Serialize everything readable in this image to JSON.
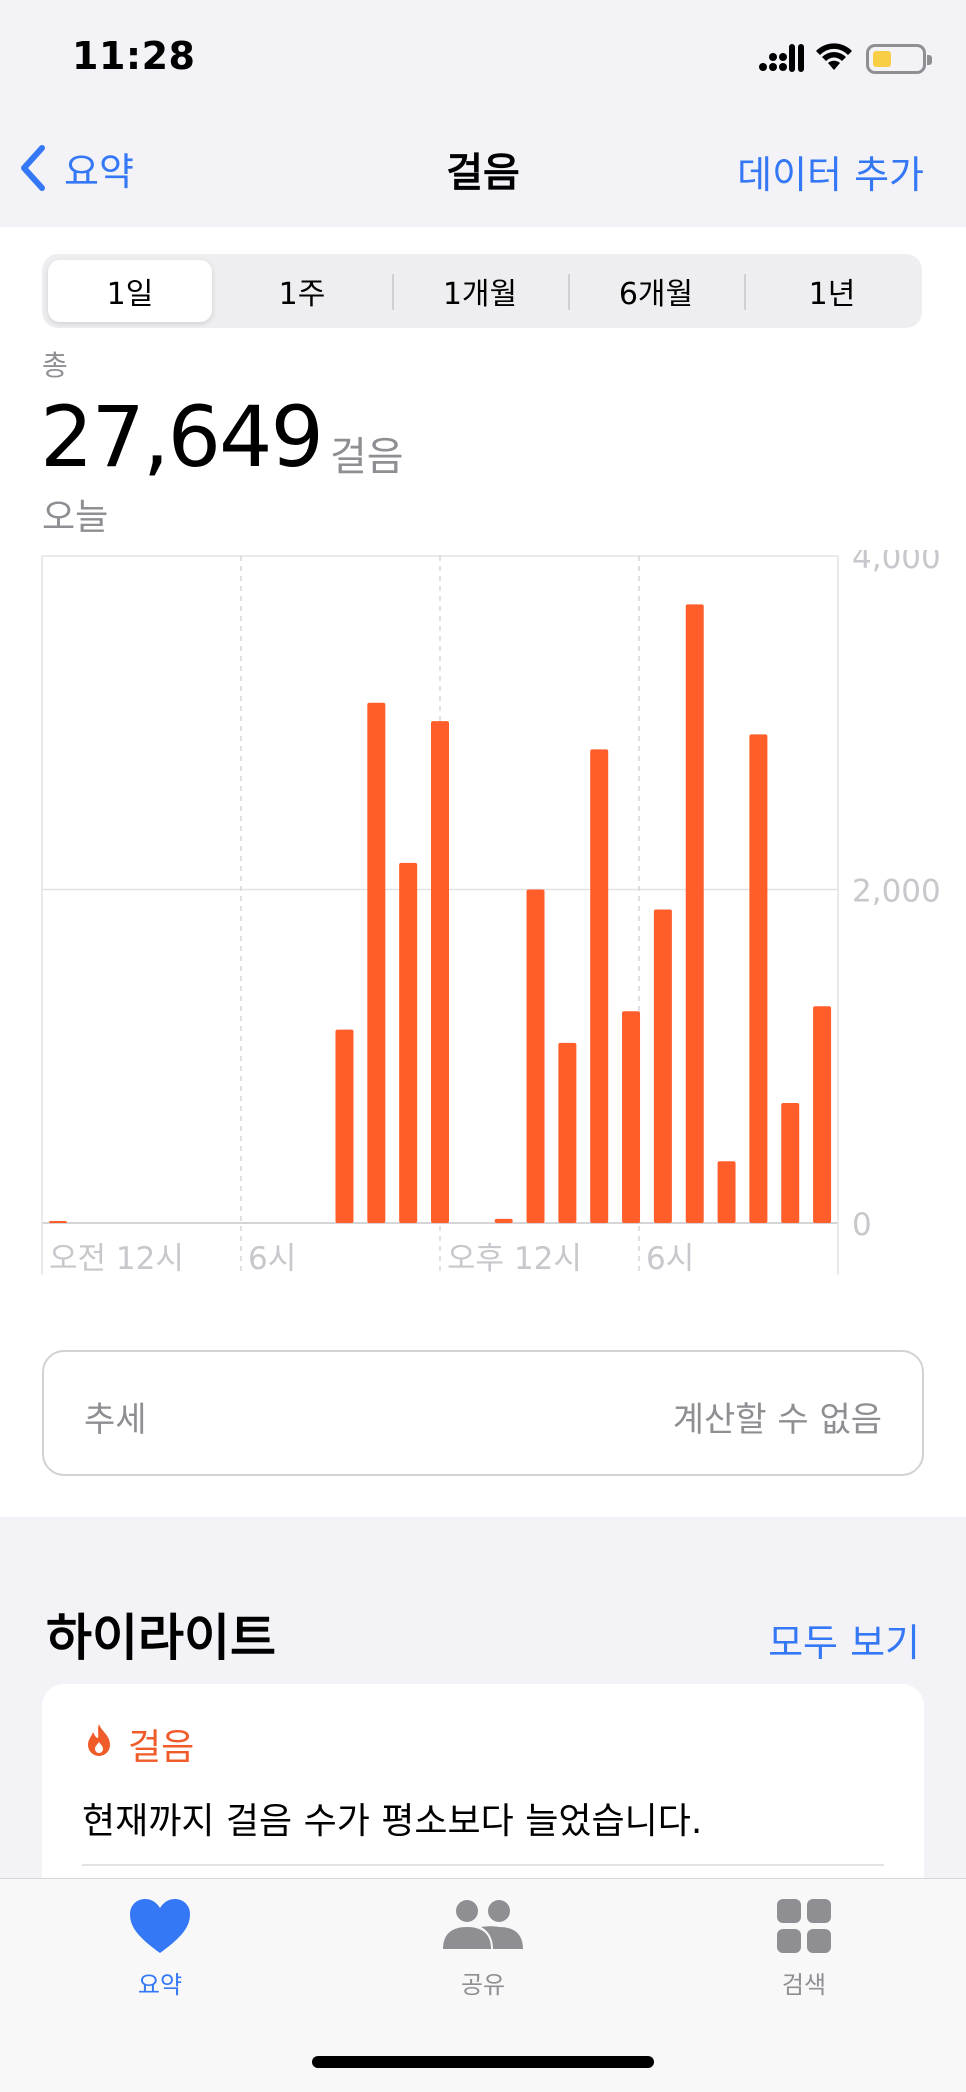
{
  "status_bar": {
    "time": "11:28"
  },
  "nav": {
    "back_label": "요약",
    "title": "걸음",
    "add_data_label": "데이터 추가"
  },
  "segments": [
    {
      "label": "1일",
      "selected": true
    },
    {
      "label": "1주",
      "selected": false
    },
    {
      "label": "1개월",
      "selected": false
    },
    {
      "label": "6개월",
      "selected": false
    },
    {
      "label": "1년",
      "selected": false
    }
  ],
  "summary": {
    "label": "총",
    "value": "27,649",
    "unit": "걸음",
    "date": "오늘"
  },
  "chart_data": {
    "type": "bar",
    "ylim": [
      0,
      4000
    ],
    "y_tick_labels": [
      "4,000",
      "2,000",
      "0"
    ],
    "y_ticks": [
      4000,
      2000,
      0
    ],
    "x_tick_labels": [
      "오전 12시",
      "6시",
      "오후 12시",
      "6시"
    ],
    "categories": [
      "0",
      "1",
      "2",
      "3",
      "4",
      "5",
      "6",
      "7",
      "8",
      "9",
      "10",
      "11",
      "12",
      "13",
      "14",
      "15",
      "16",
      "17",
      "18",
      "19",
      "20",
      "21",
      "22",
      "23"
    ],
    "values": [
      10,
      0,
      0,
      0,
      0,
      0,
      0,
      0,
      0,
      1160,
      3120,
      2160,
      3010,
      0,
      25,
      2000,
      1080,
      2840,
      1270,
      1880,
      3710,
      370,
      2930,
      720,
      1300
    ],
    "bar_color": "#ff5e2b",
    "grid": true
  },
  "trend": {
    "label": "추세",
    "value": "계산할 수 없음"
  },
  "highlights": {
    "title": "하이라이트",
    "show_all_label": "모두 보기",
    "card": {
      "category": "걸음",
      "text": "현재까지 걸음 수가 평소보다 늘었습니다."
    }
  },
  "tab_bar": {
    "items": [
      {
        "label": "요약",
        "icon": "heart-icon",
        "active": true
      },
      {
        "label": "공유",
        "icon": "people-icon",
        "active": false
      },
      {
        "label": "검색",
        "icon": "grid-icon",
        "active": false
      }
    ]
  },
  "colors": {
    "accent": "#3478f6",
    "bar": "#ff5e2b",
    "secondary_text": "#8e8e93"
  }
}
